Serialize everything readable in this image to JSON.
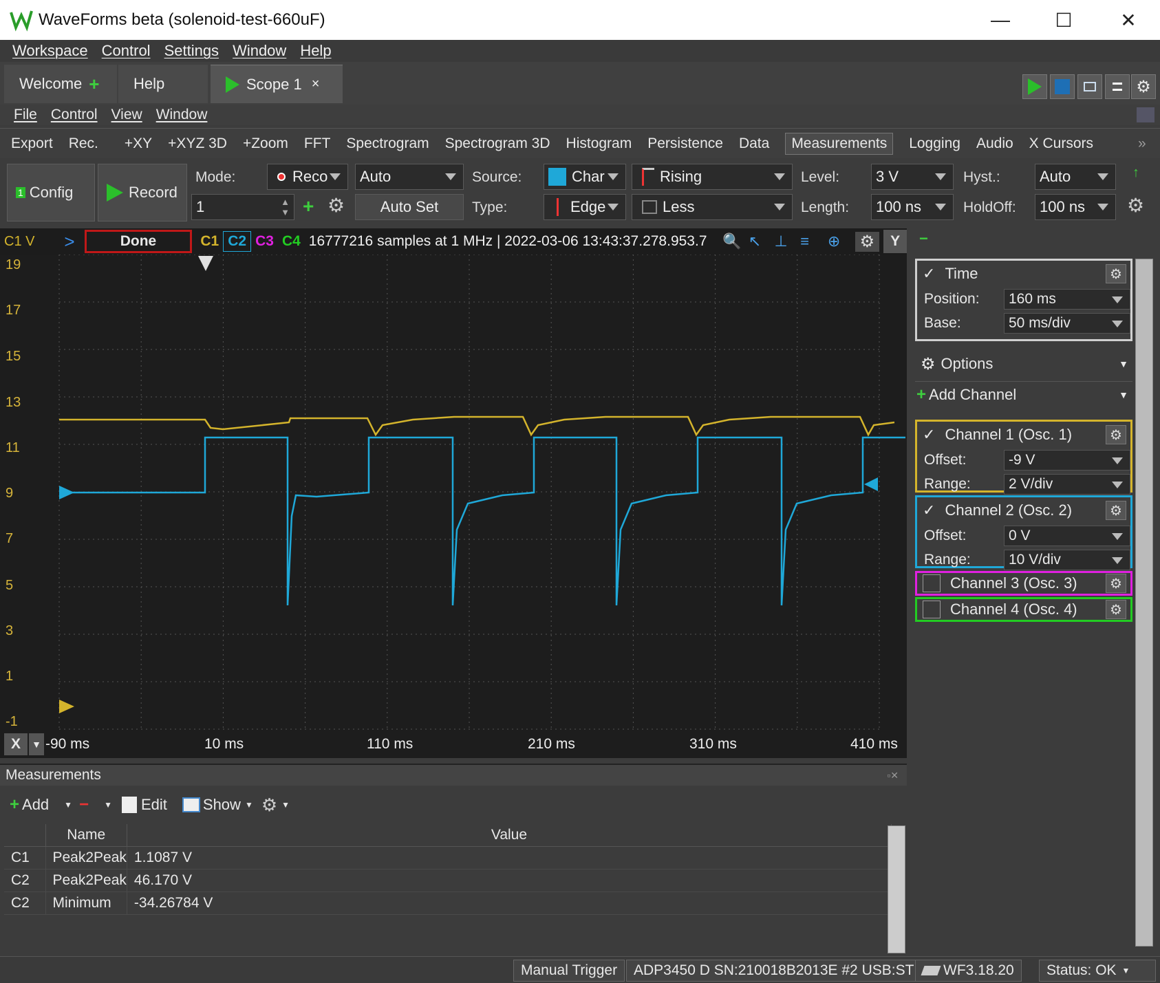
{
  "window": {
    "title": "WaveForms beta (solenoid-test-660uF)",
    "minimize": "—",
    "maximize": "☐",
    "close": "✕"
  },
  "menubar": [
    "Workspace",
    "Control",
    "Settings",
    "Window",
    "Help"
  ],
  "tabs": {
    "welcome": "Welcome",
    "help": "Help",
    "scope": "Scope 1",
    "scope_close": "×"
  },
  "instrument_menu": [
    "File",
    "Control",
    "View",
    "Window"
  ],
  "toolbar": [
    "Export",
    "Rec.",
    "+XY",
    "+XYZ 3D",
    "+Zoom",
    "FFT",
    "Spectrogram",
    "Spectrogram 3D",
    "Histogram",
    "Persistence",
    "Data",
    "Measurements",
    "Logging",
    "Audio",
    "X Cursors"
  ],
  "toolbar_selected": "Measurements",
  "controls": {
    "config_label": "Config",
    "config_badge": "1",
    "record_label": "Record",
    "mode_label": "Mode:",
    "mode_value": "Reco",
    "auto_value": "Auto",
    "count_value": "1",
    "auto_set": "Auto Set",
    "source_label": "Source:",
    "source_value": "Char",
    "edge_polarity": "Rising",
    "type_label": "Type:",
    "type_value": "Edge",
    "condition_value": "Less",
    "level_label": "Level:",
    "level_value": "3 V",
    "length_label": "Length:",
    "length_value": "100 ns",
    "hyst_label": "Hyst.:",
    "hyst_value": "Auto",
    "holdoff_label": "HoldOff:",
    "holdoff_value": "100 ns"
  },
  "plot_header": {
    "axis_unit": "C1 V",
    "status": "Done",
    "channels": [
      "C1",
      "C2",
      "C3",
      "C4"
    ],
    "info": "16777216 samples at 1 MHz | 2022-03-06 13:43:37.278.953.7",
    "y_button": "Y"
  },
  "plot": {
    "y_ticks": [
      "19",
      "17",
      "15",
      "13",
      "11",
      "9",
      "7",
      "5",
      "3",
      "1",
      "-1"
    ],
    "x_button": "X",
    "x_ticks": [
      "-90 ms",
      "10 ms",
      "110 ms",
      "210 ms",
      "310 ms",
      "410 ms"
    ],
    "colors": {
      "c1": "#d4b42c",
      "c2": "#1fa8d8",
      "c3": "#e020e0",
      "c4": "#22cc22",
      "grid": "#555555"
    }
  },
  "measurements": {
    "title": "Measurements",
    "add": "Add",
    "edit": "Edit",
    "show": "Show",
    "columns": [
      "Name",
      "Value"
    ],
    "rows": [
      {
        "ch": "C1",
        "name": "Peak2Peak",
        "value": "1.1087 V"
      },
      {
        "ch": "C2",
        "name": "Peak2Peak",
        "value": "46.170 V"
      },
      {
        "ch": "C2",
        "name": "Minimum",
        "value": "-34.26784 V"
      }
    ]
  },
  "rpanel": {
    "time": {
      "title": "Time",
      "position_label": "Position:",
      "position": "160 ms",
      "base_label": "Base:",
      "base": "50 ms/div"
    },
    "options": "Options",
    "add_channel": "Add Channel",
    "channels": [
      {
        "title": "Channel 1 (Osc. 1)",
        "offset_label": "Offset:",
        "offset": "-9 V",
        "range_label": "Range:",
        "range": "2 V/div"
      },
      {
        "title": "Channel 2 (Osc. 2)",
        "offset_label": "Offset:",
        "offset": "0 V",
        "range_label": "Range:",
        "range": "10 V/div"
      },
      {
        "title": "Channel 3 (Osc. 3)"
      },
      {
        "title": "Channel 4 (Osc. 4)"
      }
    ]
  },
  "status": {
    "trigger": "Manual Trigger",
    "device": "ADP3450 D SN:210018B2013E #2 USB:ST",
    "version": "WF3.18.20",
    "status": "Status: OK"
  }
}
